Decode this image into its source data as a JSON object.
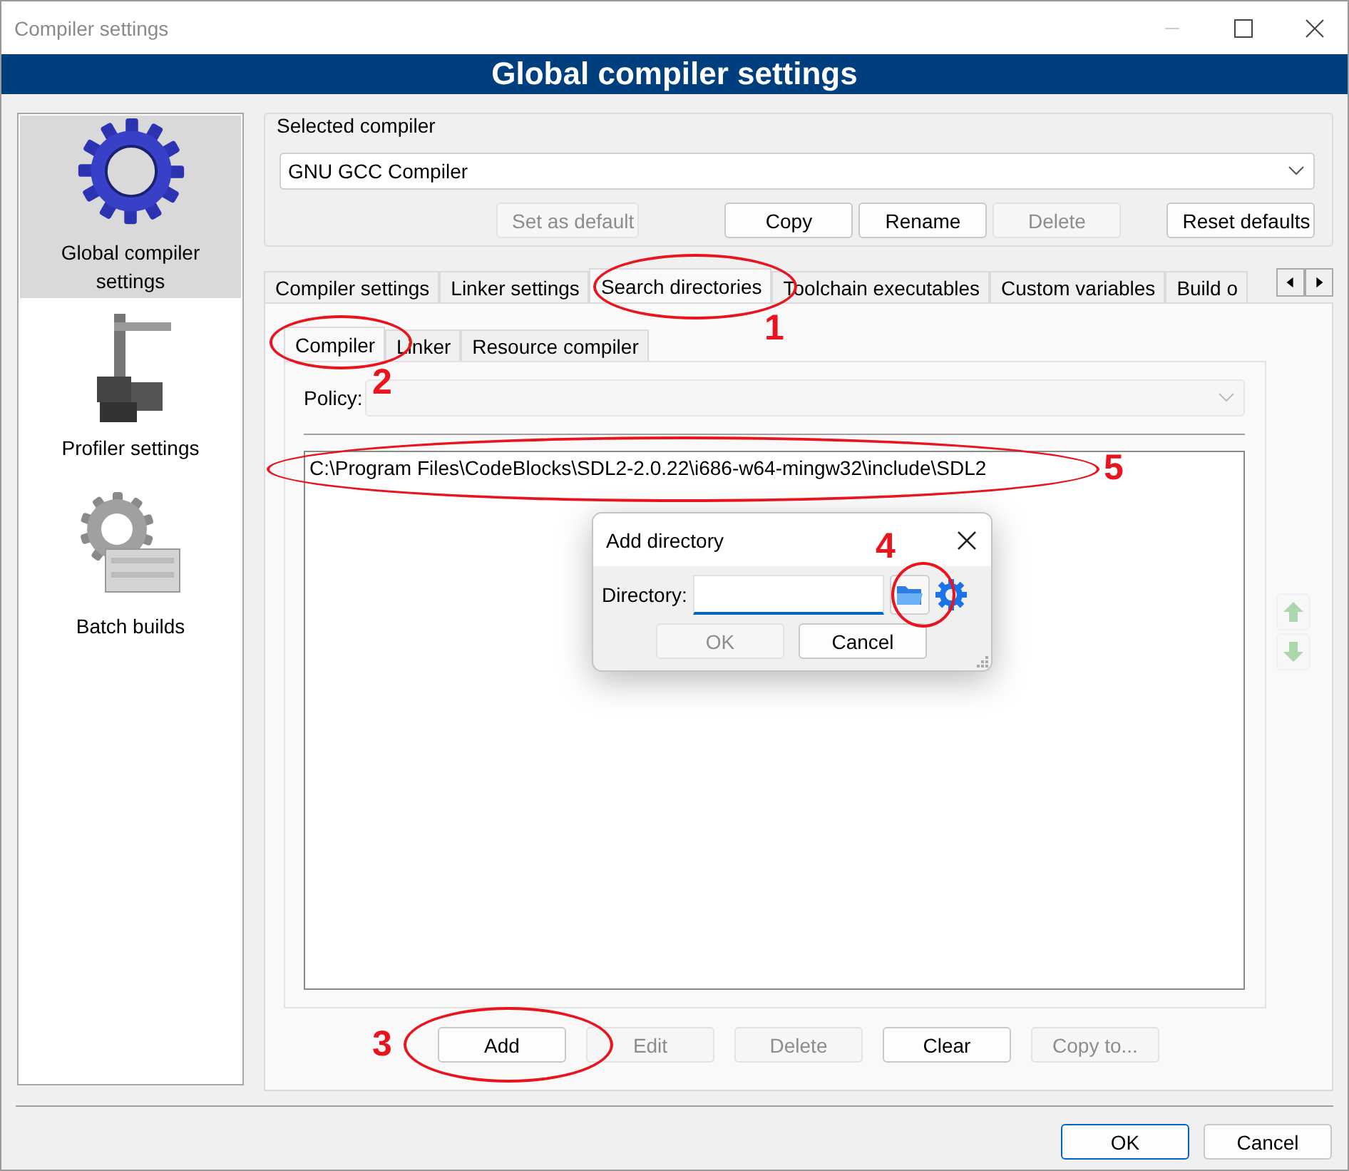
{
  "window": {
    "title": "Compiler settings"
  },
  "header": {
    "title": "Global compiler settings"
  },
  "sidebar": {
    "items": [
      {
        "label": "Global compiler settings",
        "kind": "gear",
        "selected": true
      },
      {
        "label": "Profiler settings",
        "kind": "calipers",
        "selected": false
      },
      {
        "label": "Batch builds",
        "kind": "batch",
        "selected": false
      }
    ]
  },
  "selected_compiler": {
    "legend": "Selected compiler",
    "value": "GNU GCC Compiler",
    "buttons": [
      {
        "label": "Set as default",
        "disabled": true
      },
      {
        "label": "Copy",
        "disabled": false
      },
      {
        "label": "Rename",
        "disabled": false
      },
      {
        "label": "Delete",
        "disabled": true
      },
      {
        "label": "Reset defaults",
        "disabled": false
      }
    ]
  },
  "tabs": [
    {
      "label": "Compiler settings",
      "selected": false
    },
    {
      "label": "Linker settings",
      "selected": false
    },
    {
      "label": "Search directories",
      "selected": true
    },
    {
      "label": "Toolchain executables",
      "selected": false
    },
    {
      "label": "Custom variables",
      "selected": false
    },
    {
      "label": "Build o",
      "selected": false
    }
  ],
  "subtabs": [
    {
      "label": "Compiler",
      "selected": true
    },
    {
      "label": "Linker",
      "selected": false
    },
    {
      "label": "Resource compiler",
      "selected": false
    }
  ],
  "policy": {
    "label": "Policy:",
    "disabled": true
  },
  "directories": [
    "C:\\Program Files\\CodeBlocks\\SDL2-2.0.22\\i686-w64-mingw32\\include\\SDL2"
  ],
  "move_buttons": [
    {
      "kind": "up",
      "disabled": true
    },
    {
      "kind": "down",
      "disabled": true
    }
  ],
  "list_buttons": [
    {
      "label": "Add",
      "disabled": false
    },
    {
      "label": "Edit",
      "disabled": true
    },
    {
      "label": "Delete",
      "disabled": true
    },
    {
      "label": "Clear",
      "disabled": false
    },
    {
      "label": "Copy to...",
      "disabled": true
    }
  ],
  "dialog": {
    "title": "Add directory",
    "label": "Directory:",
    "buttons": [
      {
        "label": "OK",
        "disabled": true
      },
      {
        "label": "Cancel",
        "disabled": false
      }
    ]
  },
  "footer_buttons": [
    {
      "label": "OK",
      "default": true
    },
    {
      "label": "Cancel",
      "default": false
    }
  ],
  "annotations": [
    {
      "label": "1"
    },
    {
      "label": "2"
    },
    {
      "label": "3"
    },
    {
      "label": "4"
    },
    {
      "label": "5"
    }
  ]
}
